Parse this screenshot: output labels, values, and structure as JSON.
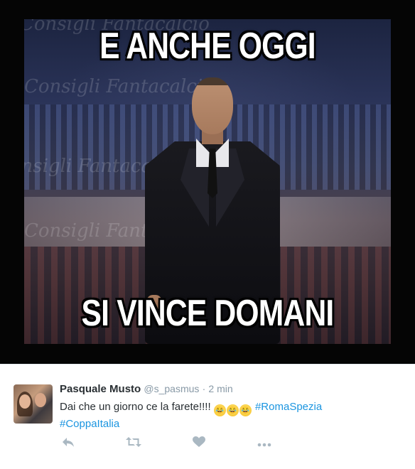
{
  "meme": {
    "caption_top": "E ANCHE OGGI",
    "caption_bottom": "SI VINCE DOMANI",
    "watermarks": [
      "Consigli Fantacalcio",
      "Consigli Fantacalcio",
      "Consigli Fantacalcio",
      "Consigli Fantacalcio"
    ]
  },
  "tweet": {
    "display_name": "Pasquale Musto",
    "username": "@s_pasmus",
    "separator": "·",
    "timestamp": "2 min",
    "text": "Dai che un giorno ce la farete!!!!",
    "emojis": [
      "😂",
      "😂",
      "😂"
    ],
    "hashtags": [
      "#RomaSpezia",
      "#CoppaItalia"
    ]
  },
  "actions": {
    "reply_icon": "reply-icon",
    "retweet_icon": "retweet-icon",
    "like_icon": "heart-icon",
    "more_icon": "more-icon"
  },
  "colors": {
    "hashtag": "#1b95e0",
    "meta": "#8899a6",
    "action": "#aab8c2"
  }
}
